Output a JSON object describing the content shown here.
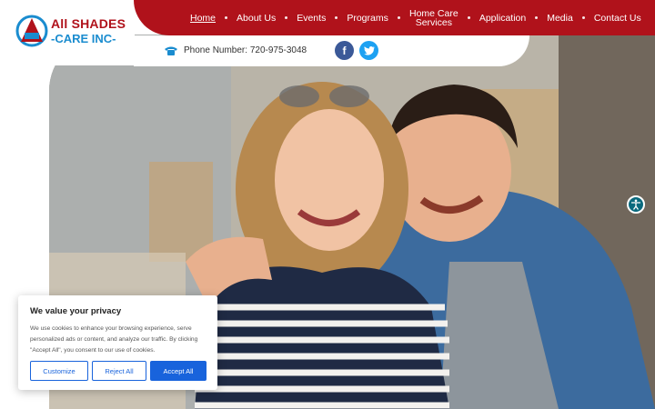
{
  "brand": {
    "logo_monogram": "A",
    "logo_badge": "ASC",
    "name_line1": "All SHADES",
    "name_line2": "-CARE INC-",
    "primary_color": "#b0121b",
    "secondary_color": "#1a8ccf"
  },
  "nav": {
    "items": [
      {
        "label": "Home",
        "active": true
      },
      {
        "label": "About Us",
        "active": false
      },
      {
        "label": "Events",
        "active": false
      },
      {
        "label": "Programs",
        "active": false
      },
      {
        "label": "Home Care Services",
        "active": false
      },
      {
        "label": "Application",
        "active": false
      },
      {
        "label": "Media",
        "active": false
      },
      {
        "label": "Contact Us",
        "active": false
      }
    ]
  },
  "contact": {
    "phone_label": "Phone Number: 720-975-3048",
    "phone_icon": "phone-icon"
  },
  "social": {
    "facebook": "f",
    "twitter": "t"
  },
  "cookie_banner": {
    "title": "We value your privacy",
    "body": "We use cookies to enhance your browsing experience, serve personalized ads or content, and analyze our traffic. By clicking \"Accept All\", you consent to our use of cookies.",
    "customize_label": "Customize",
    "reject_label": "Reject All",
    "accept_label": "Accept All",
    "button_color": "#1863dc"
  },
  "accessibility": {
    "icon": "accessibility-icon"
  }
}
